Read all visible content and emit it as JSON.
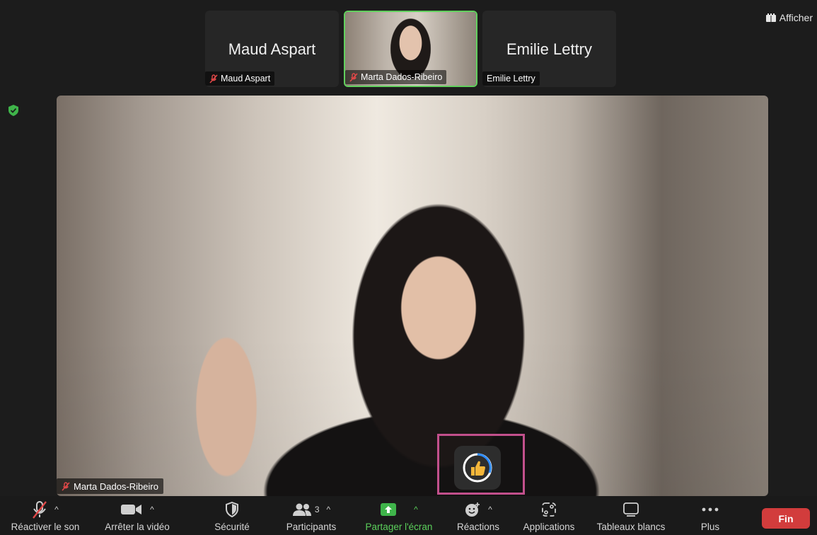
{
  "view_button": {
    "label": "Afficher",
    "icon": "grid-view-icon"
  },
  "thumbnails": [
    {
      "big_name": "Maud Aspart",
      "name": "Maud Aspart",
      "muted": true,
      "video": false
    },
    {
      "big_name": "",
      "name": "Marta Dados-Ribeiro",
      "muted": true,
      "video": true,
      "active_speaker": true
    },
    {
      "big_name": "Emilie Lettry",
      "name": "Emilie Lettry",
      "muted": false,
      "video": false
    }
  ],
  "main_video": {
    "name": "Marta Dados-Ribeiro",
    "muted": true
  },
  "reaction": {
    "icon": "thumbs-up-icon",
    "emoji": "👍"
  },
  "toolbar": {
    "unmute": "Réactiver le son",
    "stop_video": "Arrêter la vidéo",
    "security": "Sécurité",
    "participants": "Participants",
    "participants_count": "3",
    "share_screen": "Partager l'écran",
    "reactions": "Réactions",
    "apps": "Applications",
    "whiteboards": "Tableaux blancs",
    "more": "Plus",
    "end": "Fin"
  },
  "colors": {
    "active_speaker_border": "#61d05d",
    "share_green": "#5bcf5b",
    "end_red": "#d23c3c",
    "highlight": "#c2508c"
  }
}
